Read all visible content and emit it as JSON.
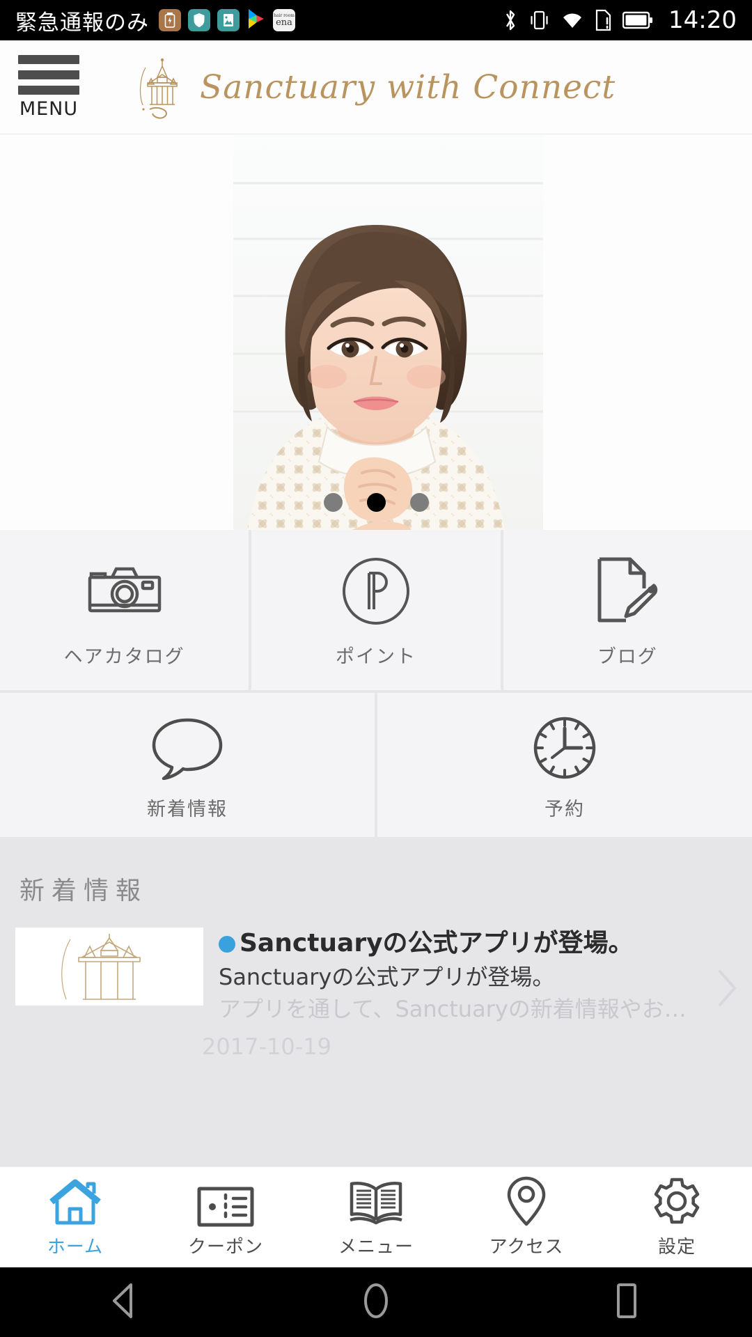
{
  "status_bar": {
    "carrier": "緊急通報のみ",
    "time": "14:20",
    "app_icons": [
      "battery-app-icon",
      "shield-app-icon",
      "gallery-app-icon",
      "play-store-icon",
      "ena-app-icon"
    ],
    "ena_top": "hair room",
    "ena_main": "ena",
    "right_icons": [
      "bluetooth-icon",
      "vibrate-icon",
      "wifi-icon",
      "sim-card-icon",
      "battery-icon"
    ]
  },
  "header": {
    "menu_label": "MENU",
    "logo_text": "Sanctuary with Connect",
    "logo_mark": "temple-logo-icon"
  },
  "hero": {
    "slide_count": 3,
    "active_index": 1,
    "alt": "hairstyle-model-photo"
  },
  "grid": {
    "row1": [
      {
        "label": "ヘアカタログ",
        "icon": "camera-icon",
        "name": "hair-catalog"
      },
      {
        "label": "ポイント",
        "icon": "point-circle-p-icon",
        "name": "point"
      },
      {
        "label": "ブログ",
        "icon": "document-pencil-icon",
        "name": "blog"
      }
    ],
    "row2": [
      {
        "label": "新着情報",
        "icon": "speech-bubble-icon",
        "name": "news"
      },
      {
        "label": "予約",
        "icon": "clock-icon",
        "name": "reservation"
      }
    ]
  },
  "news": {
    "section_title": "新着情報",
    "items": [
      {
        "headline": "Sanctuaryの公式アプリが登場。",
        "line1": "Sanctuaryの公式アプリが登場。",
        "line2": "アプリを通して、Sanctuaryの新着情報やお…",
        "date": "2017-10-19",
        "thumb": "temple-logo-thumbnail"
      }
    ]
  },
  "tabbar": [
    {
      "label": "ホーム",
      "icon": "home-icon",
      "active": true
    },
    {
      "label": "クーポン",
      "icon": "coupon-ticket-icon",
      "active": false
    },
    {
      "label": "メニュー",
      "icon": "open-book-icon",
      "active": false
    },
    {
      "label": "アクセス",
      "icon": "map-pin-icon",
      "active": false
    },
    {
      "label": "設定",
      "icon": "gear-icon",
      "active": false
    }
  ],
  "android_nav": [
    "back-triangle-icon",
    "home-circle-icon",
    "recents-square-icon"
  ],
  "colors": {
    "accent_blue": "#3ba3dd",
    "logo_gold": "#b9945f",
    "grid_bg": "#e6e6e9",
    "cell_bg": "#f4f4f6",
    "icon_gray": "#555555"
  }
}
